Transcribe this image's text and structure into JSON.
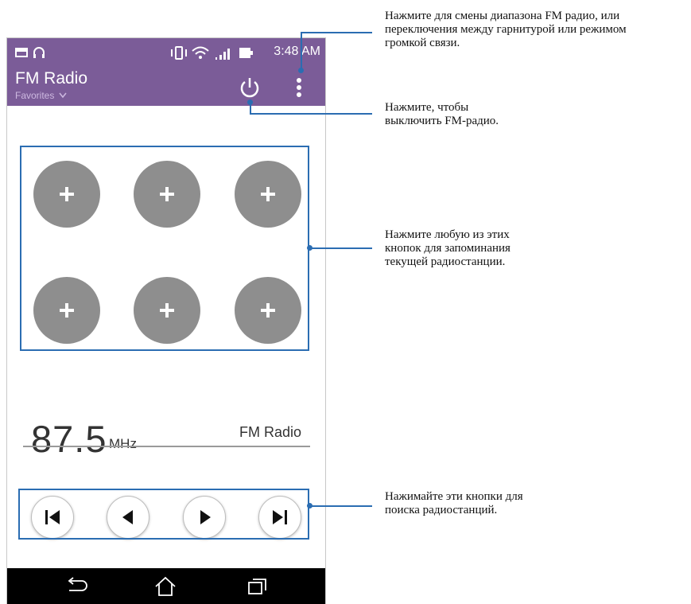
{
  "status_bar": {
    "time": "3:48 AM"
  },
  "app_bar": {
    "title": "FM Radio",
    "subtitle": "Favorites"
  },
  "presets": {
    "button_symbol": "+"
  },
  "tuner": {
    "frequency": "87.5",
    "unit": "MHz",
    "band_label": "FM Radio"
  },
  "callouts": {
    "menu_line1": "Нажмите для смены диапазона FM радио, или",
    "menu_line2": "переключения между гарнитурой или режимом",
    "menu_line3": "громкой связи.",
    "power_line1": "Нажмите, чтобы",
    "power_line2": "выключить FM-радио.",
    "presets_line1": "Нажмите любую из этих",
    "presets_line2": "кнопок для запоминания",
    "presets_line3": "текущей радиостанции.",
    "controls_line1": "Нажимайте эти кнопки для",
    "controls_line2": "поиска радиостанций."
  },
  "colors": {
    "appbar": "#7b5c98",
    "preset": "#8e8e8e",
    "callout": "#2b6db2"
  }
}
